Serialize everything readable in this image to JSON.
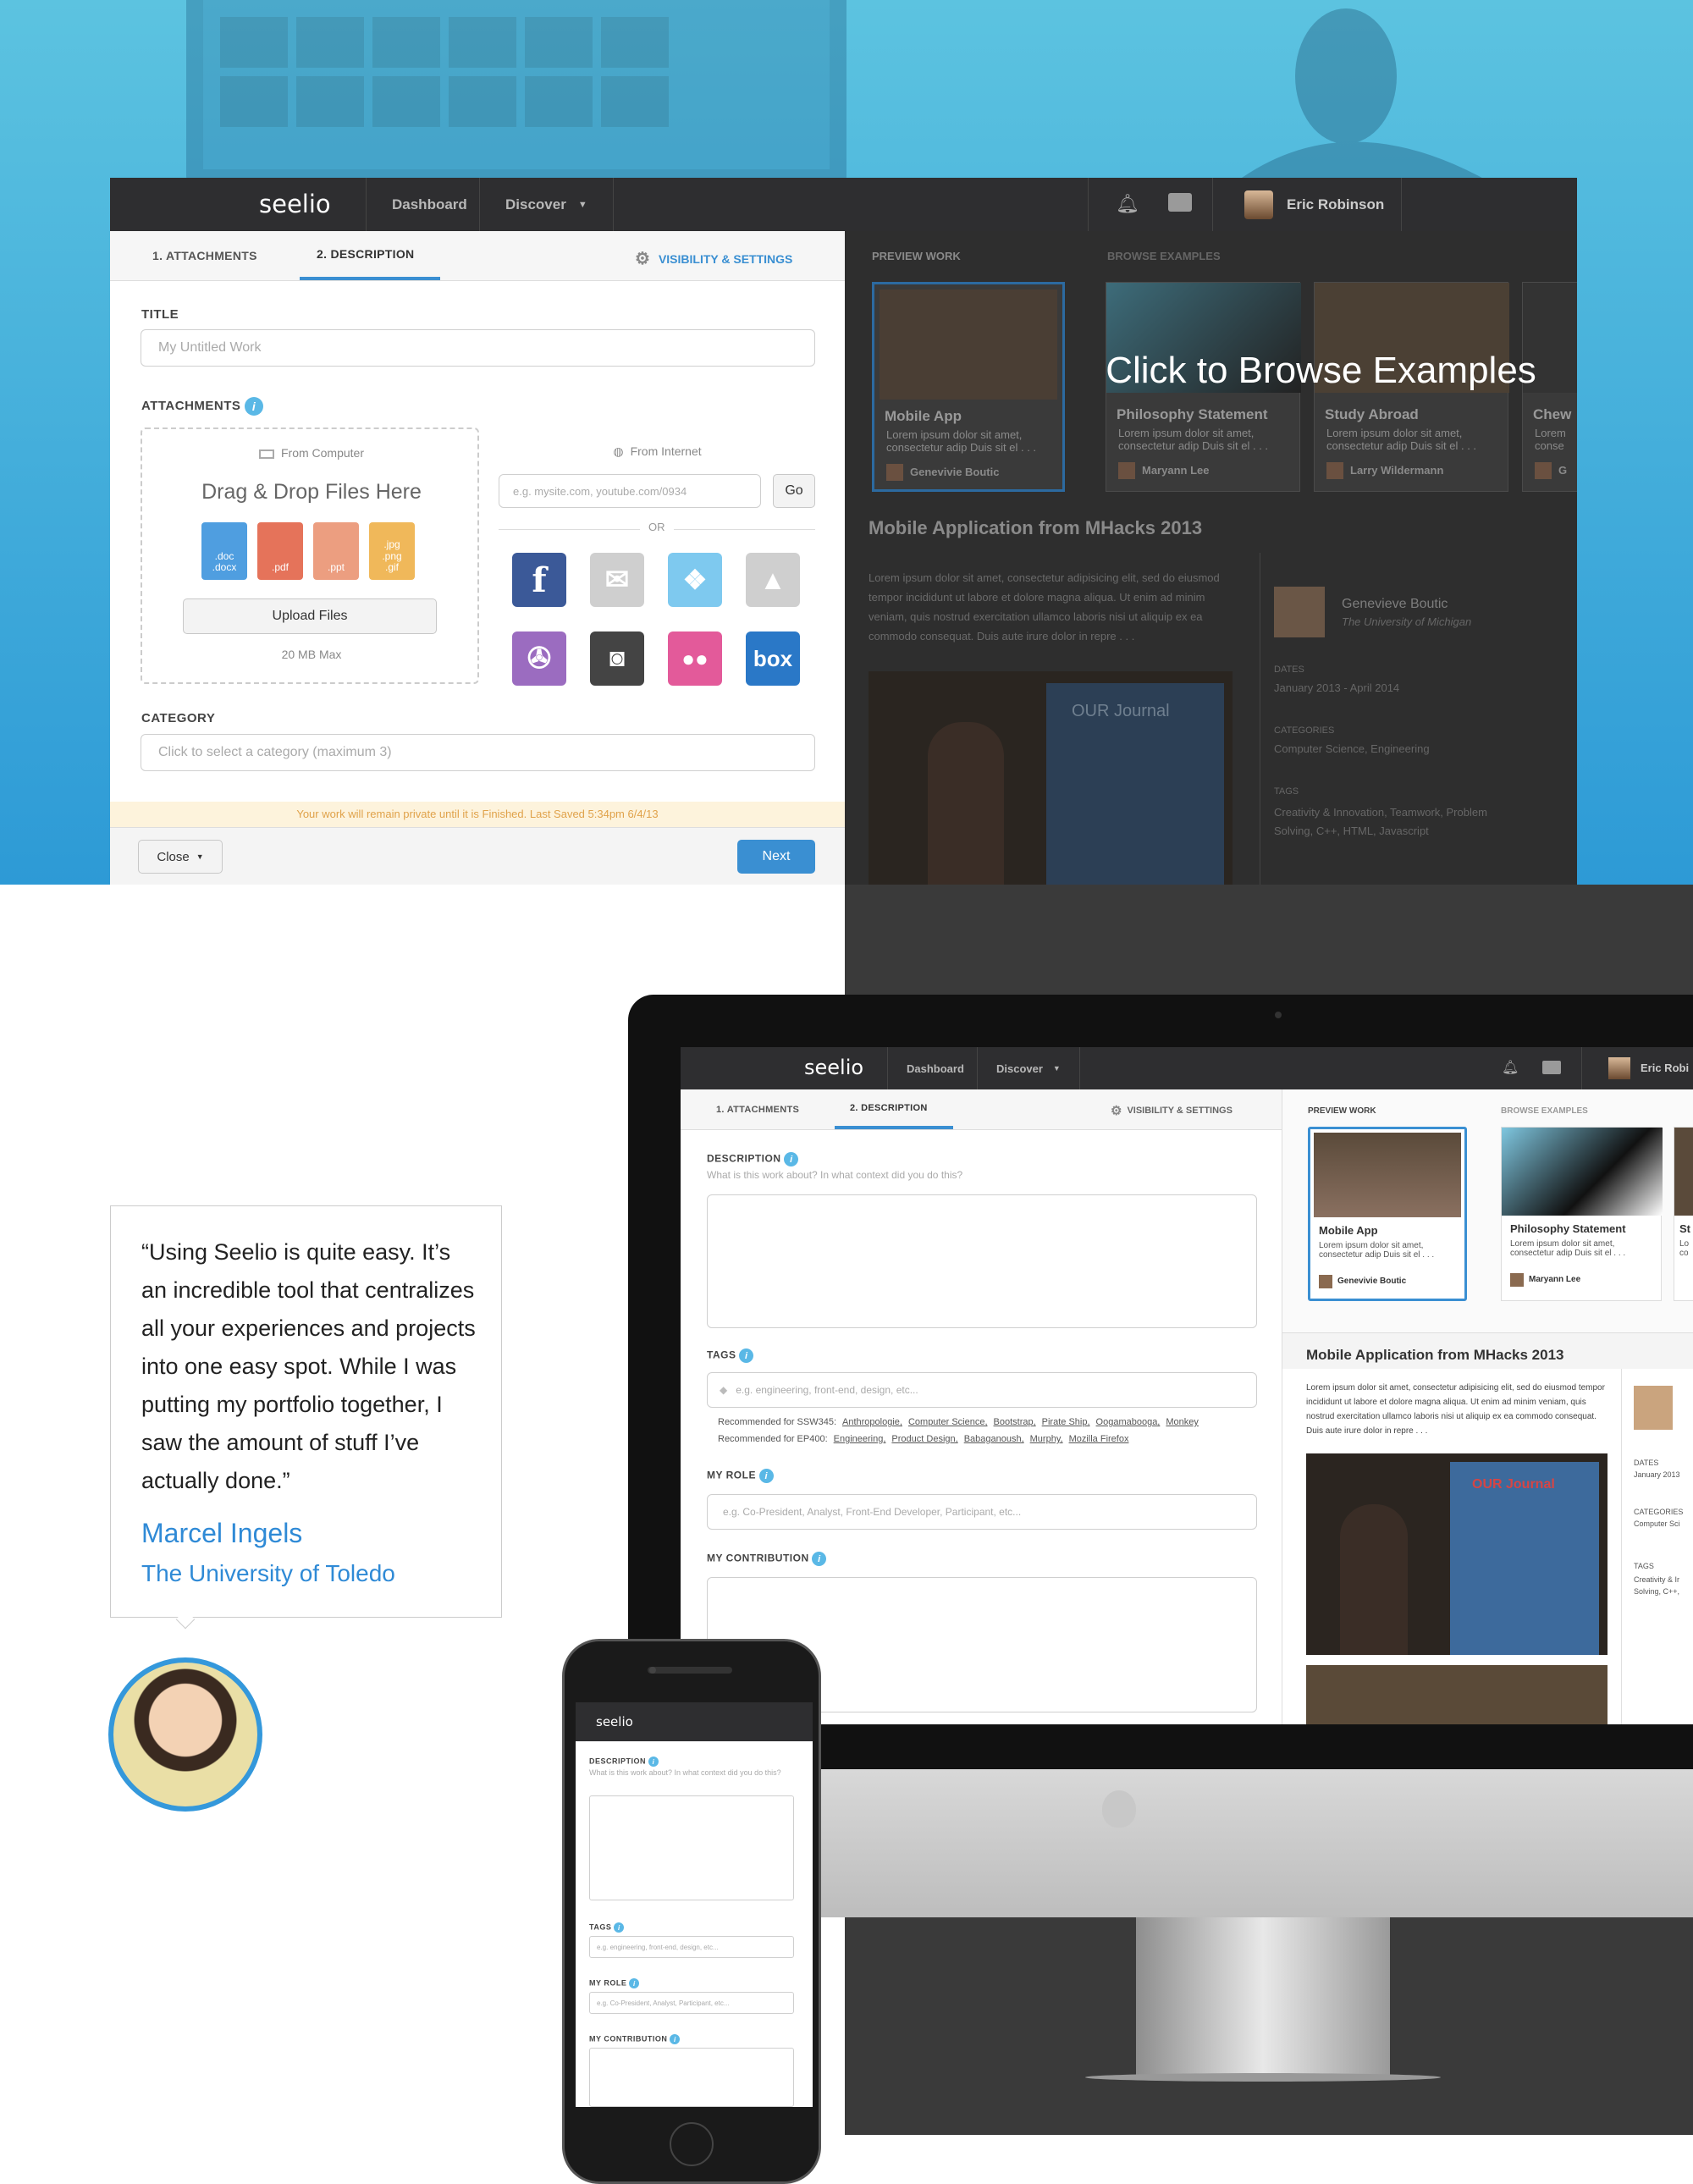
{
  "app": {
    "logo": "seelio",
    "nav": [
      "Dashboard",
      "Discover"
    ],
    "user_name": "Eric Robinson"
  },
  "form": {
    "tabs": [
      "1. ATTACHMENTS",
      "2. DESCRIPTION"
    ],
    "settings_link": "VISIBILITY & SETTINGS",
    "title_label": "TITLE",
    "title_placeholder": "My Untitled Work",
    "attachments_label": "ATTACHMENTS",
    "from_computer": "From Computer",
    "drag_drop": "Drag & Drop Files Here",
    "file_types": [
      ".doc\n.docx",
      ".pdf",
      ".ppt",
      ".jpg\n.png\n.gif"
    ],
    "upload_button": "Upload Files",
    "max_size": "20 MB Max",
    "from_internet": "From Internet",
    "url_placeholder": "e.g. mysite.com, youtube.com/0934",
    "go_button": "Go",
    "or": "OR",
    "category_label": "CATEGORY",
    "category_placeholder": "Click to select a category (maximum 3)",
    "save_notice": "Your work will remain private until it is Finished. Last Saved 5:34pm 6/4/13",
    "close_button": "Close",
    "next_button": "Next"
  },
  "preview": {
    "preview_work": "PREVIEW WORK",
    "browse_examples": "BROWSE EXAMPLES",
    "overlay_text": "Click to Browse Examples",
    "cards": [
      {
        "title": "Mobile App",
        "body": "Lorem ipsum dolor sit amet, consectetur adip Duis sit el . . .",
        "author": "Genevivie Boutic"
      },
      {
        "title": "Philosophy Statement",
        "body": "Lorem ipsum dolor sit amet, consectetur adip Duis sit el . . .",
        "author": "Maryann Lee"
      },
      {
        "title": "Study Abroad",
        "body": "Lorem ipsum dolor sit amet, consectetur adip Duis sit el . . .",
        "author": "Larry Wildermann"
      },
      {
        "title": "Chew",
        "body": "Lorem conse",
        "author": "G"
      }
    ],
    "work_title": "Mobile Application from MHacks 2013",
    "work_body": "Lorem ipsum dolor sit amet, consectetur adipisicing elit, sed do eiusmod tempor incididunt ut labore et dolore magna aliqua. Ut enim ad minim veniam, quis nostrud exercitation ullamco laboris nisi ut aliquip ex ea commodo consequat. Duis aute irure dolor in repre . . .",
    "author_name": "Genevieve Boutic",
    "author_school": "The University of Michigan",
    "dates_label": "DATES",
    "dates": "January 2013 - April 2014",
    "categories_label": "CATEGORIES",
    "categories": "Computer Science, Engineering",
    "tags_label": "TAGS",
    "tags": "Creativity & Innovation, Teamwork, Problem Solving, C++, HTML, Javascript",
    "poster_text": "OUR Journal"
  },
  "testimonial": {
    "quote": "“Using Seelio is quite easy. It’s an incredible tool that centralizes all your experiences and projects into one easy spot. While I was putting my portfolio together, I saw the amount of stuff I’ve actually done.”",
    "name": "Marcel Ingels",
    "school": "The University of Toledo"
  },
  "imac": {
    "logo": "seelio",
    "nav": [
      "Dashboard",
      "Discover"
    ],
    "user_name": "Eric Robi",
    "tabs": [
      "1. ATTACHMENTS",
      "2. DESCRIPTION"
    ],
    "settings_link": "VISIBILITY & SETTINGS",
    "description_label": "DESCRIPTION",
    "description_hint": "What is this work about? In what context did you do this?",
    "tags_label": "TAGS",
    "tags_placeholder": "e.g. engineering, front-end, design, etc...",
    "rec1_label": "Recommended for SSW345:",
    "rec1_tags": [
      "Anthropologie,",
      "Computer Science,",
      "Bootstrap,",
      "Pirate Ship,",
      "Oogamabooga,",
      "Monkey"
    ],
    "rec2_label": "Recommended for EP400:",
    "rec2_tags": [
      "Engineering,",
      "Product Design,",
      "Babaganoush,",
      "Murphy,",
      "Mozilla Firefox"
    ],
    "role_label": "MY ROLE",
    "role_placeholder": "e.g. Co-President, Analyst, Front-End Developer, Participant, etc...",
    "contribution_label": "MY CONTRIBUTION",
    "preview_work": "PREVIEW WORK",
    "browse_examples": "BROWSE EXAMPLES",
    "card1_title": "Mobile App",
    "card1_body": "Lorem ipsum dolor sit amet, consectetur adip Duis sit el . . .",
    "card1_author": "Genevivie Boutic",
    "card2_title": "Philosophy Statement",
    "card2_body": "Lorem ipsum dolor sit amet, consectetur adip Duis sit el . . .",
    "card2_author": "Maryann Lee",
    "card3_title": "St",
    "card3_body": "Lo co",
    "work_title": "Mobile Application from MHacks 2013",
    "work_body": "Lorem ipsum dolor sit amet, consectetur adipisicing elit, sed do eiusmod tempor incididunt ut labore et dolore magna aliqua. Ut enim ad minim veniam, quis nostrud exercitation ullamco laboris nisi ut aliquip ex ea commodo consequat. Duis aute irure dolor in repre . . .",
    "dates_label": "DATES",
    "dates": "January 2013",
    "categories_label": "CATEGORIES",
    "categories": "Computer Sci",
    "tags2_label": "TAGS",
    "tags2": "Creativity & Ir Solving, C++,",
    "poster_text": "OUR Journal"
  },
  "phone": {
    "logo": "seelio",
    "description_label": "DESCRIPTION",
    "description_hint": "What is this work about? In what context did you do this?",
    "tags_label": "TAGS",
    "tags_placeholder": "e.g. engineering, front-end, design, etc...",
    "role_label": "MY ROLE",
    "role_placeholder": "e.g. Co-President, Analyst, Participant, etc...",
    "contribution_label": "MY CONTRIBUTION"
  },
  "colors": {
    "accent": "#3a8fd2",
    "topbar": "#2e2e30",
    "hero_top": "#5cc3e0",
    "hero_bottom": "#2d9ad6",
    "notice_bg": "#fdf3dc",
    "notice_text": "#e0a24a"
  },
  "icons": {
    "bell": "bell-icon",
    "chat": "chat-icon",
    "gear": "gear-icon",
    "laptop": "laptop-icon",
    "globe": "globe-icon",
    "tag": "tag-icon",
    "services": [
      "facebook-icon",
      "mail-icon",
      "dropbox-icon",
      "google-drive-icon",
      "picasa-icon",
      "instagram-icon",
      "flickr-icon",
      "box-icon"
    ]
  }
}
